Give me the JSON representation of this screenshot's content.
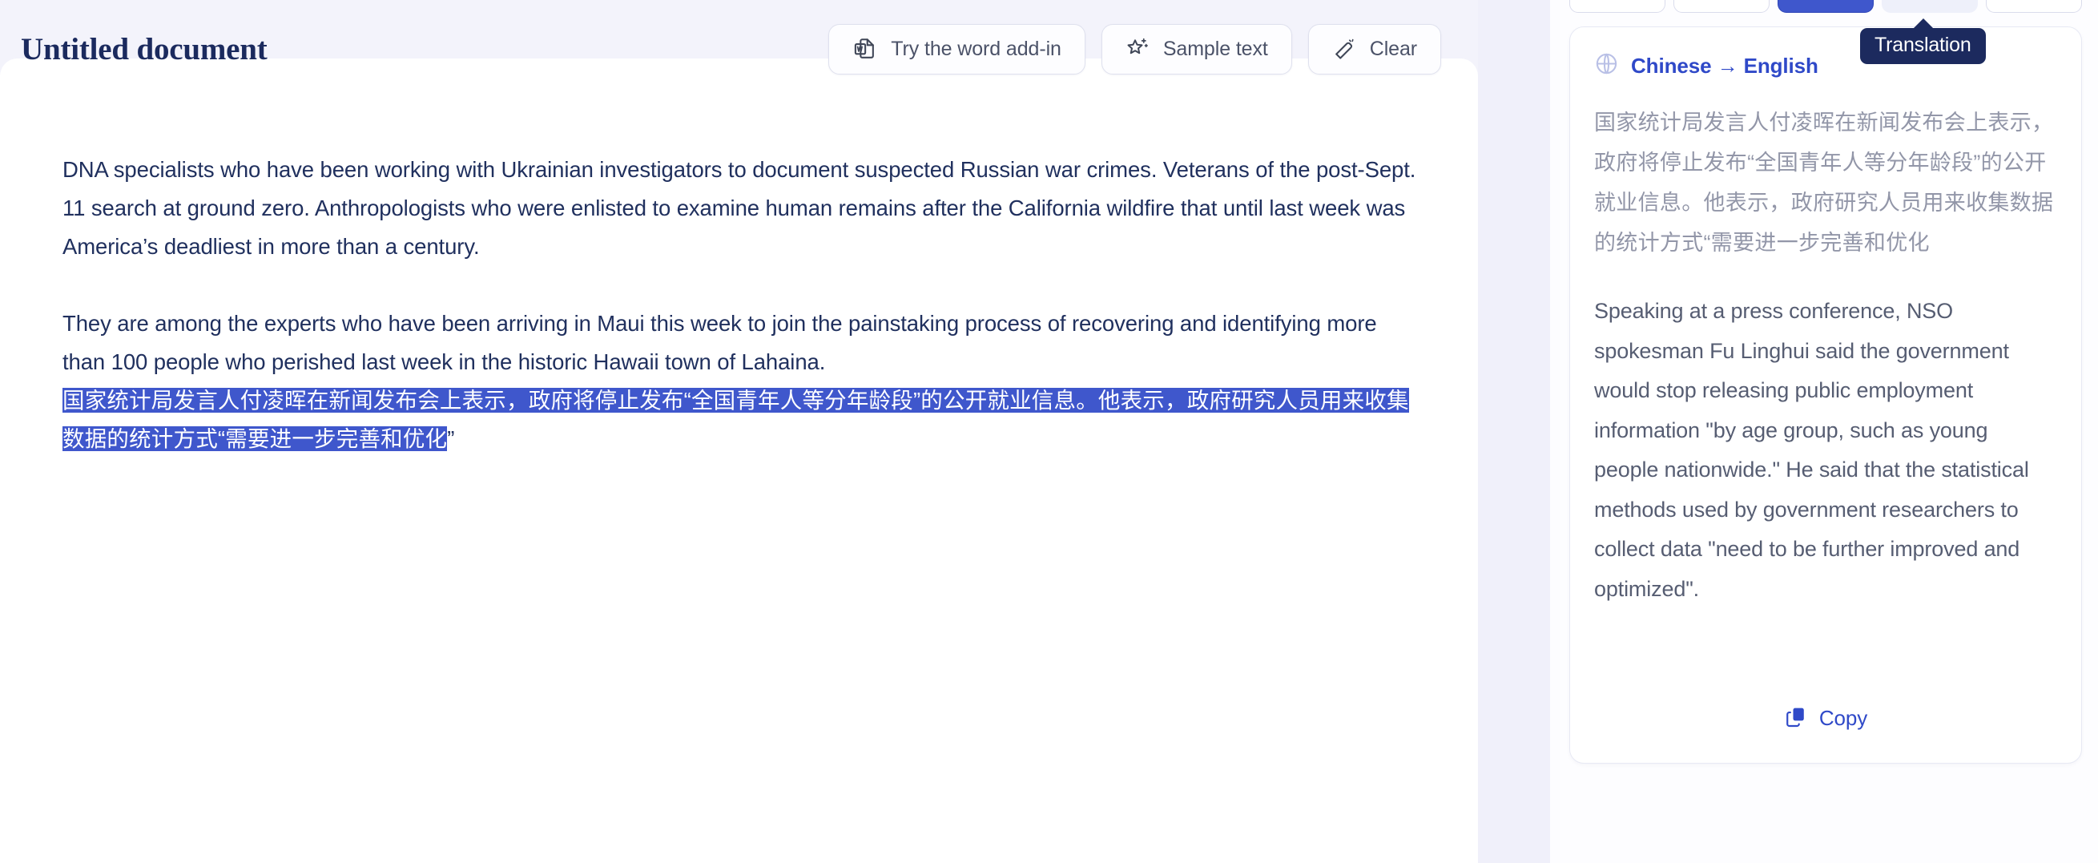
{
  "editor": {
    "title": "Untitled document",
    "toolbar": {
      "word_addin_label": "Try the word add-in",
      "word_addin_icon": "word-document-icon",
      "sample_text_label": "Sample text",
      "sample_text_icon": "sparkle-star-icon",
      "clear_label": "Clear",
      "clear_icon": "eraser-icon"
    },
    "document": {
      "paragraph_1": "DNA specialists who have been working with Ukrainian investigators to document suspected Russian war crimes. Veterans of the post-Sept. 11 search at ground zero. Anthropologists who were enlisted to examine human remains after the California wildfire that until last week was America’s deadliest in more than a century.",
      "paragraph_2": "They are among the experts who have been arriving in Maui this week to join the painstaking process of recovering and identifying more than 100 people who perished last week in the historic Hawaii town of Lahaina.",
      "paragraph_3_selected": "国家统计局发言人付凌晖在新闻发布会上表示，政府将停止发布“全国青年人等分年龄段”的公开就业信息。他表示，政府研究人员用来收集数据的统计方式“需要进一步完善和优化",
      "paragraph_3_trailing": "”"
    }
  },
  "sidebar": {
    "tooltip": {
      "label": "Translation"
    },
    "translation_card": {
      "globe_icon": "globe-icon",
      "language_pair": "Chinese → English",
      "source_text": "国家统计局发言人付凌晖在新闻发布会上表示，政府将停止发布“全国青年人等分年龄段”的公开就业信息。他表示，政府研究人员用来收集数据的统计方式“需要进一步完善和优化",
      "translated_text": "Speaking at a press conference, NSO spokesman Fu Linghui said the government would stop releasing public employment information \"by age group, such as young people nationwide.\" He said that the statistical methods used by government researchers to collect data \"need to be further improved and optimized\".",
      "copy_label": "Copy",
      "copy_icon": "copy-icon"
    }
  },
  "colors": {
    "page_background": "#f3f3fb",
    "sheet_background": "#ffffff",
    "title_navy": "#1b2a5e",
    "body_navy": "#20305e",
    "selection_blue": "#3f57cc",
    "accent_blue": "#2f49c8",
    "tooltip_navy": "#1c2a5e",
    "muted_gray": "#9296a8",
    "translation_gray": "#565d72"
  }
}
